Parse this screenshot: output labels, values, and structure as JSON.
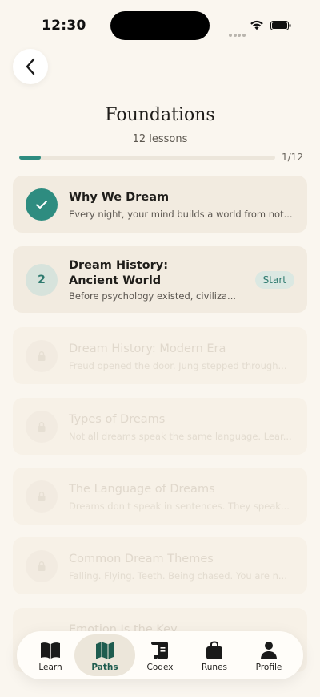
{
  "status": {
    "time": "12:30"
  },
  "header": {
    "title": "Foundations",
    "subtitle": "12 lessons",
    "progress_label": "1/12",
    "progress_fraction": 0.083
  },
  "lessons": [
    {
      "number": "✓",
      "title_line1": "Why We Dream",
      "title_line2": "",
      "description": "Every night, your mind builds a world from not...",
      "state": "completed"
    },
    {
      "number": "2",
      "title_line1": "Dream History:",
      "title_line2": "Ancient World",
      "description": "Before psychology existed, civiliza...",
      "state": "current",
      "action": "Start"
    },
    {
      "title_line1": "Dream History: Modern Era",
      "description": "Freud opened the door. Jung stepped through...",
      "state": "locked"
    },
    {
      "title_line1": "Types of Dreams",
      "description": "Not all dreams speak the same language. Lear...",
      "state": "locked"
    },
    {
      "title_line1": "The Language of Dreams",
      "description": "Dreams don't speak in sentences. They speak...",
      "state": "locked"
    },
    {
      "title_line1": "Common Dream Themes",
      "description": "Falling. Flying. Teeth. Being chased. You are n...",
      "state": "locked"
    },
    {
      "title_line1": "Emotion Is the Key",
      "description": "",
      "state": "locked"
    }
  ],
  "nav": [
    {
      "label": "Learn",
      "icon": "book-icon",
      "active": false
    },
    {
      "label": "Paths",
      "icon": "map-icon",
      "active": true
    },
    {
      "label": "Codex",
      "icon": "scroll-icon",
      "active": false
    },
    {
      "label": "Runes",
      "icon": "bag-icon",
      "active": false
    },
    {
      "label": "Profile",
      "icon": "person-icon",
      "active": false
    }
  ],
  "colors": {
    "accent": "#2e8c80",
    "background": "#faf6ef",
    "card": "#f2ebe0"
  }
}
